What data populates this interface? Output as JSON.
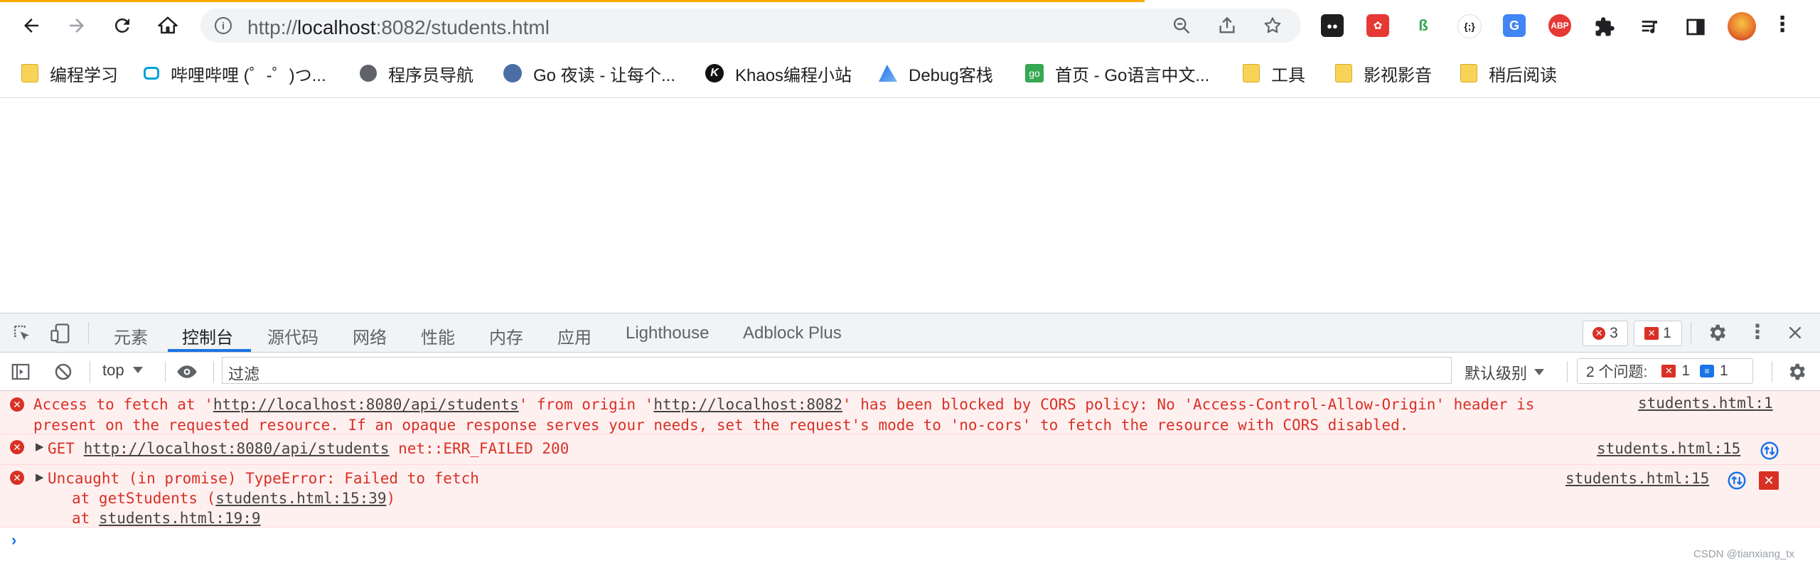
{
  "browser": {
    "url_scheme": "http://",
    "url_host": "localhost",
    "url_rest": ":8082/students.html",
    "buttons": {
      "back": "back",
      "forward": "forward",
      "reload": "reload",
      "home": "home"
    },
    "extensions": [
      {
        "name": "tampermonkey-icon",
        "color": "#1f1f1f",
        "label": "●●"
      },
      {
        "name": "dev-extension-icon",
        "color": "#e53935",
        "label": "✿"
      },
      {
        "name": "leaf-extension-icon",
        "color": "#ffffff",
        "label": "ß"
      },
      {
        "name": "json-extension-icon",
        "color": "#ffffff",
        "label": "{;}"
      },
      {
        "name": "translate-icon",
        "color": "#4285f4",
        "label": "G"
      },
      {
        "name": "adblock-plus-icon",
        "color": "#e53935",
        "label": "ABP"
      },
      {
        "name": "puzzle-icon",
        "color": "#ffffff",
        "label": ""
      },
      {
        "name": "media-queue-icon",
        "color": "#ffffff",
        "label": ""
      },
      {
        "name": "side-panel-icon",
        "color": "#ffffff",
        "label": ""
      },
      {
        "name": "profile-avatar",
        "color": "#e8772e",
        "label": ""
      },
      {
        "name": "more-menu-icon",
        "color": "#ffffff",
        "label": "⋮"
      }
    ]
  },
  "bookmarks": [
    {
      "label": "编程学习",
      "icon": "folder-icon"
    },
    {
      "label": "哔哩哔哩 (゜-゜)つ...",
      "icon": "bilibili-icon"
    },
    {
      "label": "程序员导航",
      "icon": "globe-icon"
    },
    {
      "label": "Go 夜读 - 让每个...",
      "icon": "avatar-icon"
    },
    {
      "label": "Khaos编程小站",
      "icon": "khaos-icon"
    },
    {
      "label": "Debug客栈",
      "icon": "debug-icon"
    },
    {
      "label": "首页 - Go语言中文...",
      "icon": "go-cn-icon"
    },
    {
      "label": "工具",
      "icon": "folder-icon"
    },
    {
      "label": "影视影音",
      "icon": "folder-icon"
    },
    {
      "label": "稍后阅读",
      "icon": "folder-icon"
    }
  ],
  "devtools": {
    "tabs": [
      "元素",
      "控制台",
      "源代码",
      "网络",
      "性能",
      "内存",
      "应用",
      "Lighthouse",
      "Adblock Plus"
    ],
    "active_tab": "控制台",
    "error_count": "3",
    "issue_count": "1",
    "context": "top",
    "filter_placeholder": "过滤",
    "level": "默认级别",
    "issues_label": "2 个问题:",
    "issues_error": "1",
    "issues_info": "1"
  },
  "console": {
    "msg1": {
      "p1": "Access to fetch at '",
      "url1": "http://localhost:8080/api/students",
      "p2": "' from origin '",
      "url2": "http://localhost:8082",
      "p3": "' has been blocked by CORS policy: No 'Access-Control-Allow-Origin' header is",
      "line2": "present on the requested resource. If an opaque response serves your needs, set the request's mode to 'no-cors' to fetch the resource with CORS disabled.",
      "source": "students.html:1"
    },
    "msg2": {
      "method": "GET",
      "url": "http://localhost:8080/api/students",
      "status": "net::ERR_FAILED 200",
      "source": "students.html:15"
    },
    "msg3": {
      "text": "Uncaught (in promise) TypeError: Failed to fetch",
      "at1_prefix": "at getStudents (",
      "at1_link": "students.html:15:39",
      "at1_suffix": ")",
      "at2_prefix": "at ",
      "at2_link": "students.html:19:9",
      "source": "students.html:15"
    }
  },
  "watermark": "CSDN @tianxiang_tx"
}
